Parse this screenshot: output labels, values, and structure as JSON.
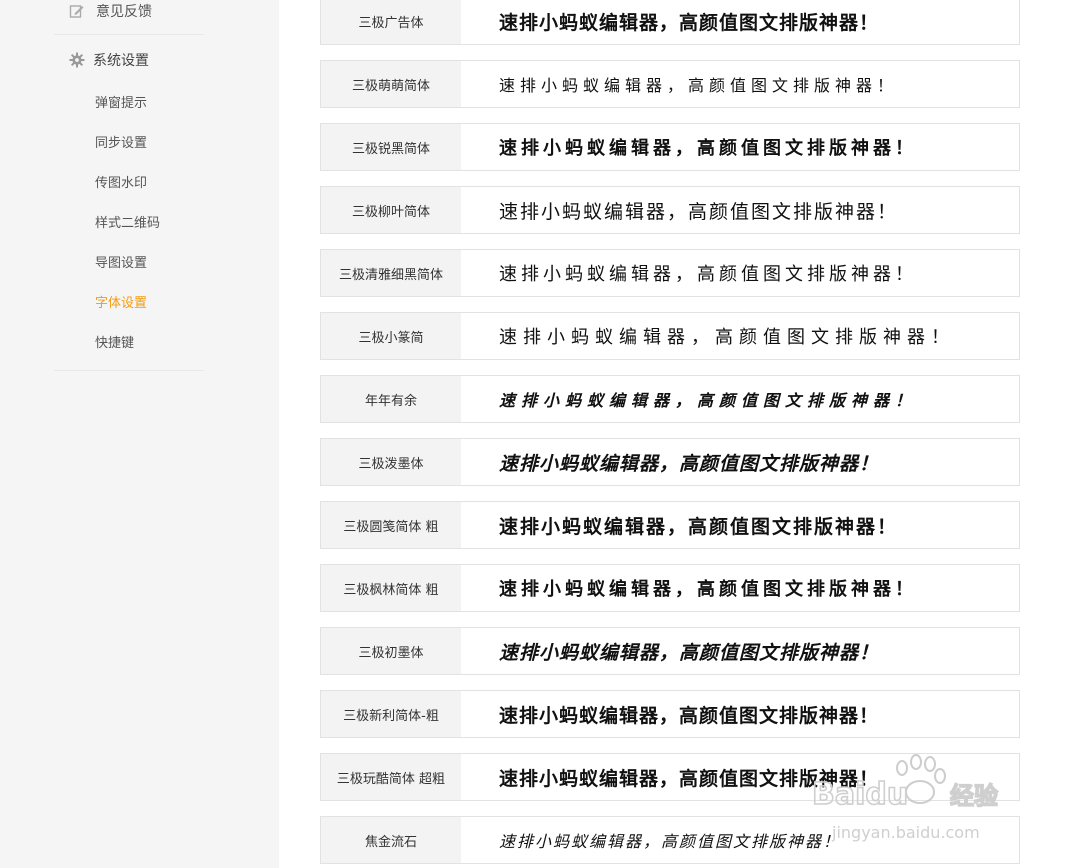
{
  "sidebar": {
    "feedback": {
      "label": "意见反馈",
      "icon": "edit-icon"
    },
    "settings": {
      "label": "系统设置",
      "icon": "gear-icon"
    },
    "items": [
      {
        "label": "弹窗提示",
        "active": false
      },
      {
        "label": "同步设置",
        "active": false
      },
      {
        "label": "传图水印",
        "active": false
      },
      {
        "label": "样式二维码",
        "active": false
      },
      {
        "label": "导图设置",
        "active": false
      },
      {
        "label": "字体设置",
        "active": true
      },
      {
        "label": "快捷键",
        "active": false
      }
    ],
    "active_color": "#f39c12"
  },
  "sample_text": "速排小蚂蚁编辑器，高颜值图文排版神器！",
  "fonts": [
    {
      "name": "三极广告体"
    },
    {
      "name": "三极萌萌简体"
    },
    {
      "name": "三极锐黑简体"
    },
    {
      "name": "三极柳叶简体"
    },
    {
      "name": "三极清雅细黑简体"
    },
    {
      "name": "三极小篆简"
    },
    {
      "name": "年年有余"
    },
    {
      "name": "三极泼墨体"
    },
    {
      "name": "三极圆笺简体 粗"
    },
    {
      "name": "三极枫林简体 粗"
    },
    {
      "name": "三极初墨体"
    },
    {
      "name": "三极新利简体-粗"
    },
    {
      "name": "三极玩酷简体 超粗"
    },
    {
      "name": "焦金流石"
    }
  ],
  "watermark": {
    "brand_text": "Baidu",
    "brand_cn": "经验",
    "url": "jingyan.baidu.com"
  }
}
